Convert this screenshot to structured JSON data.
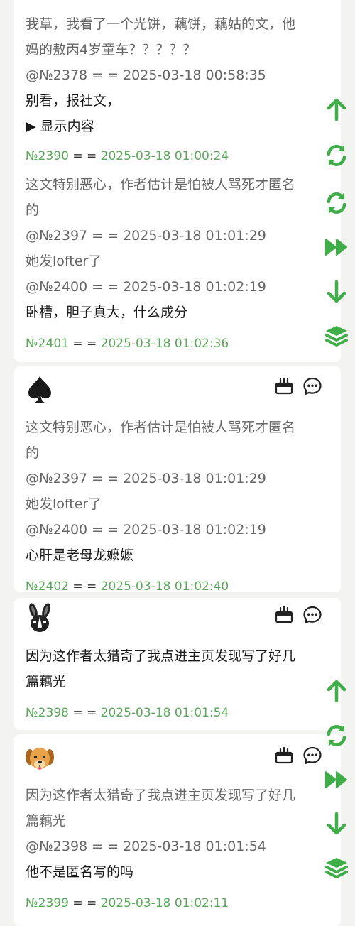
{
  "accent_color": "#3fae49",
  "post_1": {
    "lines": [
      "我草，我看了一个光饼，藕饼，藕姑的文，他",
      "妈的敖丙4岁童车？？？？？",
      "@№2378 = = 2025-03-18 00:58:35",
      "别看，报社文，"
    ],
    "toggle": "▶ 显示内容",
    "meta": {
      "no": "№2390",
      "eq": " = = ",
      "ts": "2025-03-18 01:00:24"
    }
  },
  "post_2": {
    "lines": [
      "这文特别恶心，作者估计是怕被人骂死才匿名",
      "的",
      "@№2397 = = 2025-03-18 01:01:29",
      "她发lofter了",
      "@№2400 = = 2025-03-18 01:02:19",
      "卧槽，胆子真大，什么成分"
    ],
    "meta": {
      "no": "№2401",
      "eq": " = = ",
      "ts": "2025-03-18 01:02:36"
    }
  },
  "post_3": {
    "avatar": "spade-icon",
    "lines": [
      "这文特别恶心，作者估计是怕被人骂死才匿名",
      "的",
      "@№2397 = = 2025-03-18 01:01:29",
      "她发lofter了",
      "@№2400 = = 2025-03-18 01:02:19",
      "心肝是老母龙嬷嬷"
    ],
    "meta": {
      "no": "№2402",
      "eq": " = = ",
      "ts": "2025-03-18 01:02:40"
    }
  },
  "post_4": {
    "avatar": "rabbit-icon",
    "lines": [
      "因为这作者太猎奇了我点进主页发现写了好几",
      "篇藕光"
    ],
    "meta": {
      "no": "№2398",
      "eq": " = = ",
      "ts": "2025-03-18 01:01:54"
    }
  },
  "post_5": {
    "avatar": "dog-icon",
    "lines": [
      "因为这作者太猎奇了我点进主页发现写了好几",
      "篇藕光",
      "@№2398 = = 2025-03-18 01:01:54",
      "他不是匿名写的吗"
    ],
    "meta": {
      "no": "№2399",
      "eq": " = = ",
      "ts": "2025-03-18 01:02:11"
    }
  },
  "floating_nav": [
    "arrow-up-icon",
    "refresh-icon",
    "refresh-icon",
    "fast-forward-icon",
    "arrow-down-icon",
    "layers-icon"
  ]
}
